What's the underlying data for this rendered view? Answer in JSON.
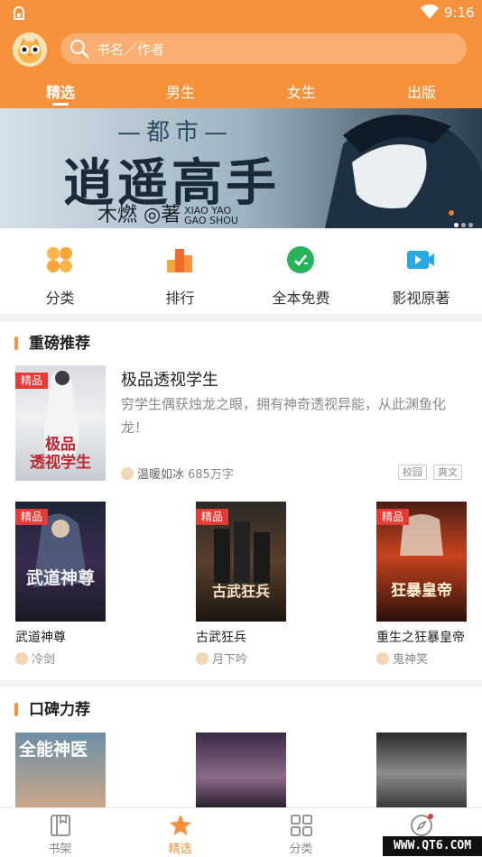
{
  "status": {
    "time": "9:16"
  },
  "search": {
    "placeholder": "书名／作者"
  },
  "tabs": [
    {
      "label": "精选",
      "active": true
    },
    {
      "label": "男生",
      "active": false
    },
    {
      "label": "女生",
      "active": false
    },
    {
      "label": "出版",
      "active": false
    }
  ],
  "banner": {
    "subtitle": "—都市—",
    "title": "逍遥高手",
    "author": "木燃 ◎著",
    "english": "XIAO YAO\nGAO SHOU"
  },
  "quick": [
    {
      "label": "分类",
      "icon": "category-icon",
      "color": "#f9a53a"
    },
    {
      "label": "排行",
      "icon": "ranking-icon",
      "color": "#f7913b"
    },
    {
      "label": "全本免费",
      "icon": "free-icon",
      "color": "#27b35b"
    },
    {
      "label": "影视原著",
      "icon": "video-icon",
      "color": "#2aa8e6"
    }
  ],
  "section1": {
    "title": "重磅推荐"
  },
  "featured": {
    "badge": "精品",
    "title": "极品透视学生",
    "desc": "穷学生偶获烛龙之眼，拥有神奇透视异能，从此渊鱼化龙！",
    "author": "温暖如冰",
    "words": "685万字",
    "tags": [
      "校园",
      "爽文"
    ],
    "cover_text": "极品\n透视学生"
  },
  "grid": [
    {
      "badge": "精品",
      "title": "武道神尊",
      "author": "冷剑",
      "cover_text": "武道神尊"
    },
    {
      "badge": "精品",
      "title": "古武狂兵",
      "author": "月下吟",
      "cover_text": "古武狂兵"
    },
    {
      "badge": "精品",
      "title": "重生之狂暴皇帝",
      "author": "鬼神笑",
      "cover_text": "狂暴皇帝"
    }
  ],
  "section2": {
    "title": "口碑力荐"
  },
  "section2_covers": [
    {
      "cover_text": "全能神医"
    },
    {
      "cover_text": ""
    },
    {
      "cover_text": ""
    }
  ],
  "tabbar": [
    {
      "label": "书架",
      "icon": "bookshelf-icon",
      "active": false
    },
    {
      "label": "精选",
      "icon": "star-icon",
      "active": true
    },
    {
      "label": "分类",
      "icon": "grid-icon",
      "active": false
    },
    {
      "label": "发现",
      "icon": "compass-icon",
      "active": false
    }
  ],
  "watermark": "WWW.QT6.COM",
  "colors": {
    "accent": "#f7913b",
    "badge": "#e53b36"
  }
}
